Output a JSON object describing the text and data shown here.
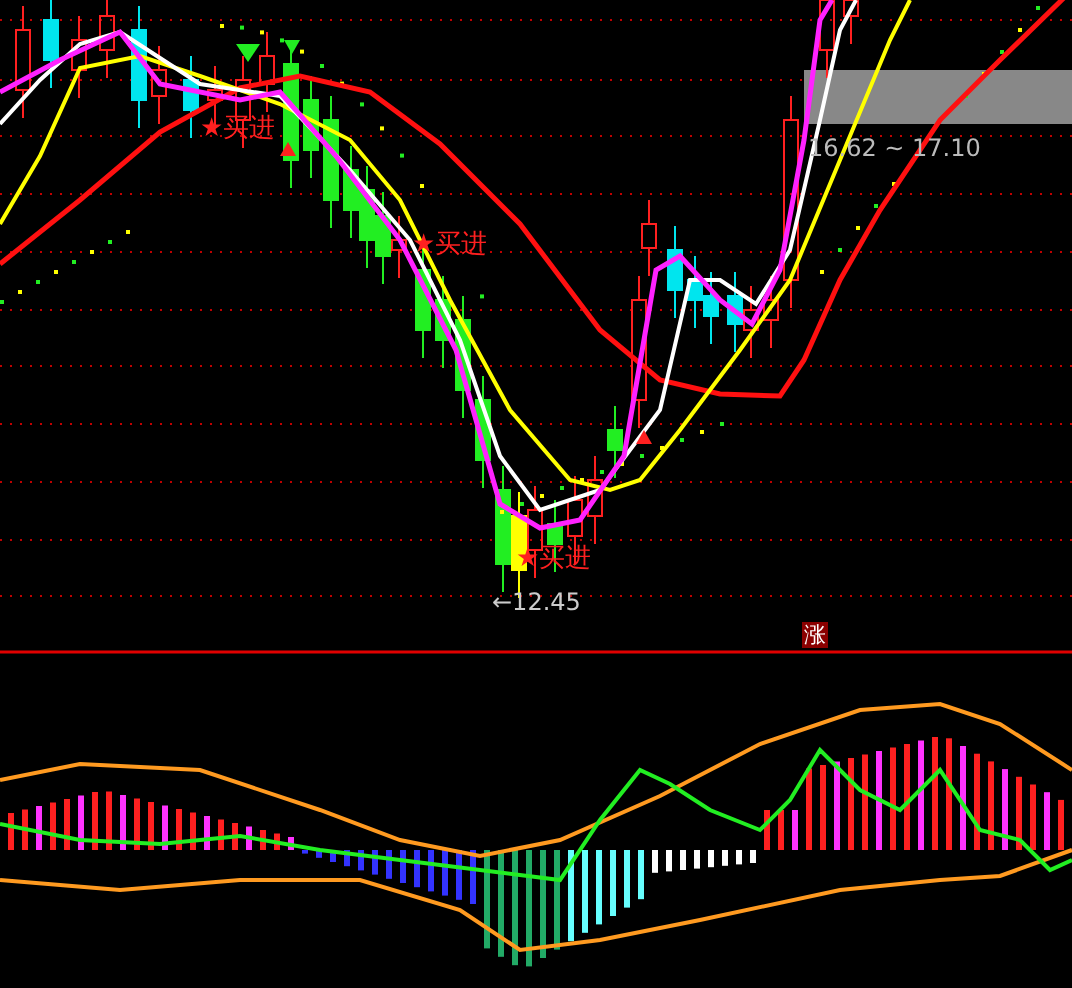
{
  "main_panel": {
    "signals": [
      {
        "kind": "buy",
        "text": "★买进"
      },
      {
        "kind": "buy",
        "text": "★买进"
      },
      {
        "kind": "buy",
        "text": "★买进"
      }
    ],
    "low_label": "←12.45",
    "target_range": "16.62 ~ 17.10"
  },
  "indicator_panel": {
    "badge": "涨"
  }
}
